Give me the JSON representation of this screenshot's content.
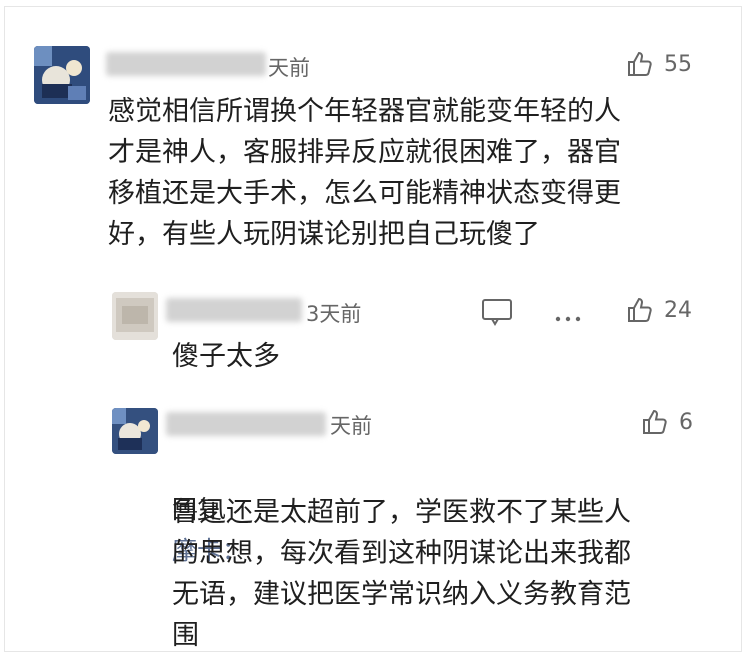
{
  "comment": {
    "time": "天前",
    "likes": "55",
    "text": "感觉相信所谓换个年轻器官就能变年轻的人\n才是神人，客服排异反应就很困难了，器官\n移植还是大手术，怎么可能精神状态变得更\n好，有些人玩阴谋论别把自己玩傻了"
  },
  "reply1": {
    "time": "3天前",
    "likes": "24",
    "text": "傻子太多"
  },
  "reply2": {
    "time": "天前",
    "likes": "6",
    "reply_prefix": "回复",
    "reply_to": "摩卡：",
    "text": "鲁迅还是太超前了，学医救不了某些人\n的思想，每次看到这种阴谋论出来我都\n无语，建议把医学常识纳入义务教育范\n围"
  },
  "icons": {
    "like": "thumbs-up-icon",
    "comment": "comment-bubble-icon",
    "more": "more-dots-icon"
  }
}
